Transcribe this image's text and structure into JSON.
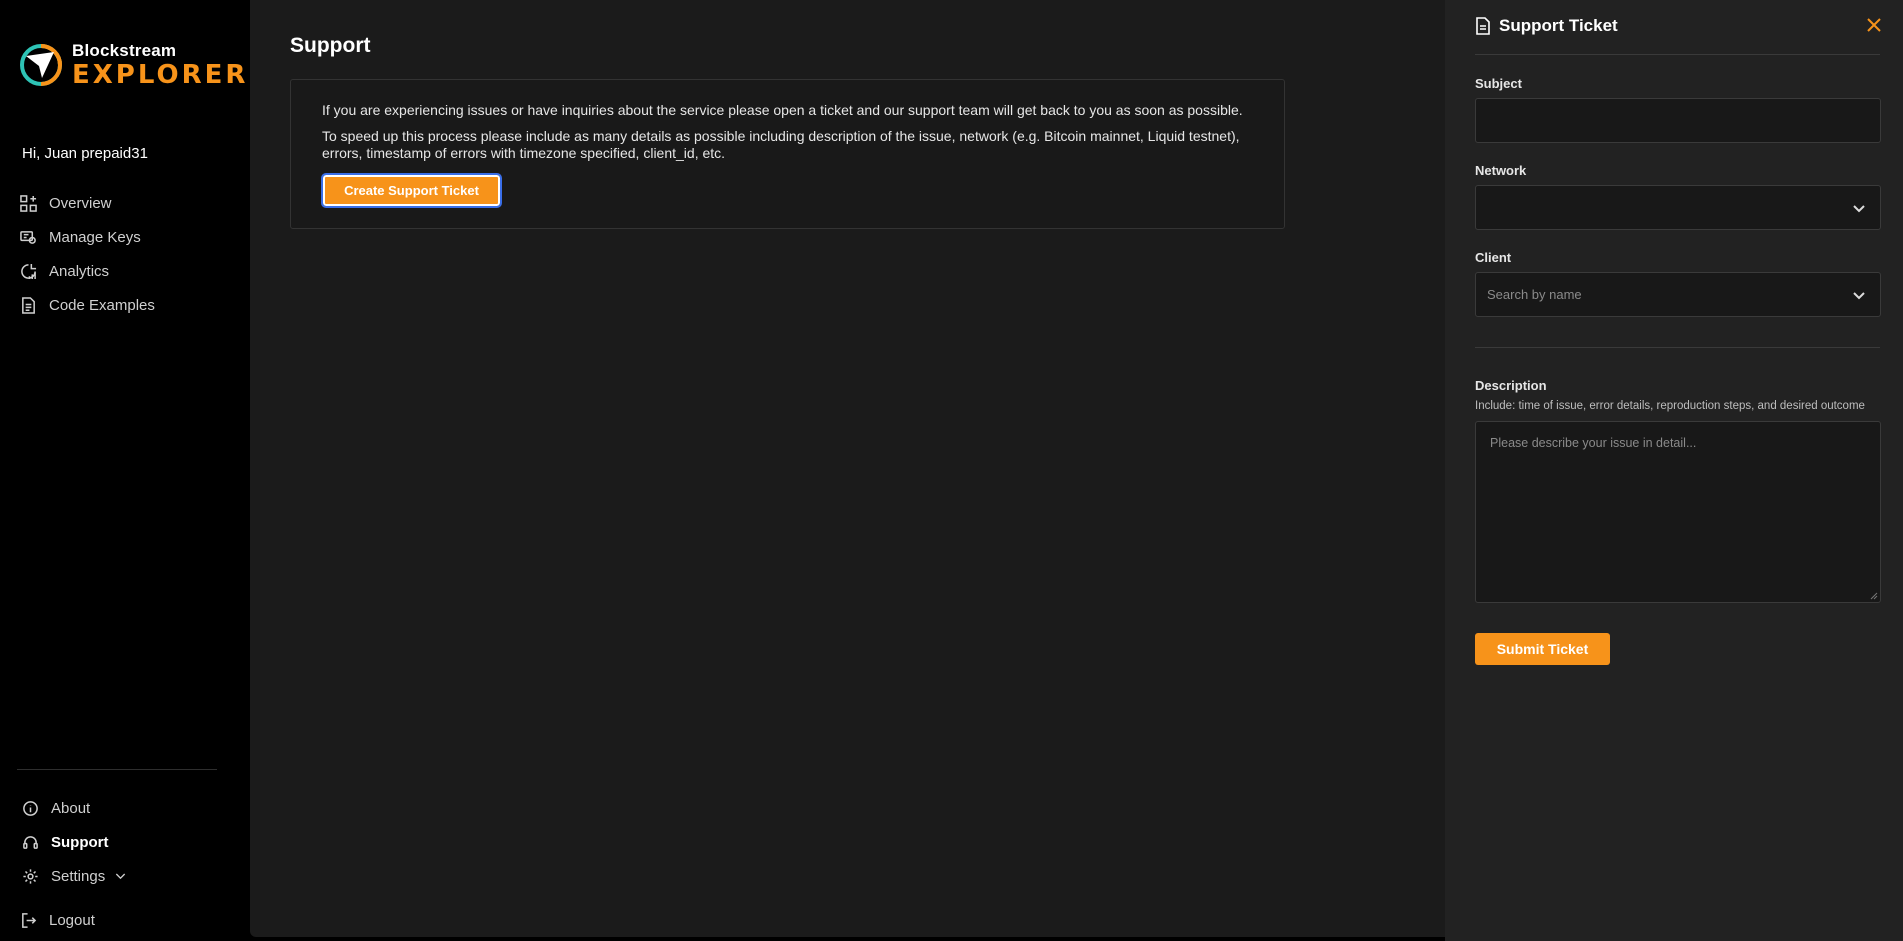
{
  "brand": {
    "line1": "Blockstream",
    "line2": "EXPLORER"
  },
  "sidebar": {
    "greeting": "Hi, Juan prepaid31",
    "items": [
      {
        "label": "Overview",
        "icon": "grid-plus-icon"
      },
      {
        "label": "Manage Keys",
        "icon": "key-icon"
      },
      {
        "label": "Analytics",
        "icon": "chart-icon"
      },
      {
        "label": "Code Examples",
        "icon": "document-icon"
      }
    ],
    "bottom_items": [
      {
        "label": "About",
        "icon": "info-icon"
      },
      {
        "label": "Support",
        "icon": "headset-icon",
        "active": true
      },
      {
        "label": "Settings",
        "icon": "gear-icon"
      }
    ],
    "logout": "Logout"
  },
  "main": {
    "title": "Support",
    "card": {
      "p1": "If you are experiencing issues or have inquiries about the service please open a ticket and our support team will get back to you as soon as possible.",
      "p2": "To speed up this process please include as many details as possible including description of the issue, network (e.g. Bitcoin mainnet, Liquid testnet), errors, timestamp of errors with timezone specified, client_id, etc.",
      "button": "Create Support Ticket"
    }
  },
  "drawer": {
    "title": "Support Ticket",
    "subject_label": "Subject",
    "subject_value": "",
    "network_label": "Network",
    "network_value": "",
    "client_label": "Client",
    "client_placeholder": "Search by name",
    "description_label": "Description",
    "description_help": "Include: time of issue, error details, reproduction steps, and desired outcome",
    "description_placeholder": "Please describe your issue in detail...",
    "submit": "Submit Ticket"
  },
  "colors": {
    "accent": "#f7931a",
    "focus_ring": "#3a6ee8"
  }
}
